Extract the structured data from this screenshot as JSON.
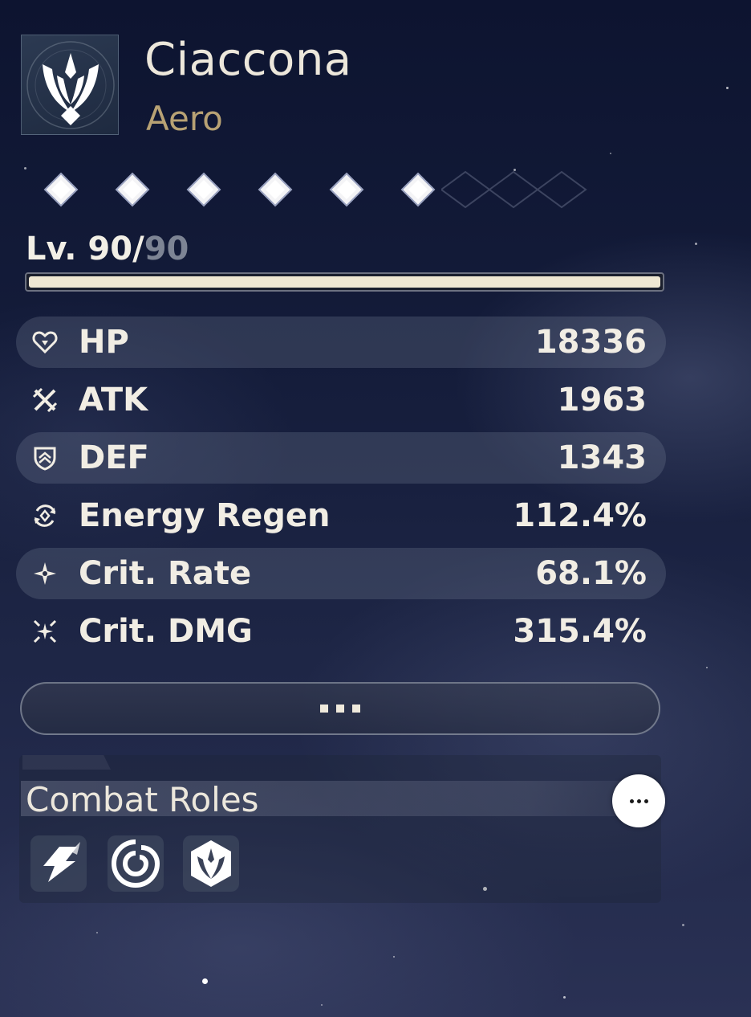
{
  "character": {
    "name": "Ciaccona",
    "element": "Aero",
    "emblem_icon": "aero-emblem-icon"
  },
  "sequence": {
    "nodes": 6,
    "node_icon": "diamond-node-icon"
  },
  "level": {
    "prefix": "Lv. ",
    "current": "90",
    "separator": "/",
    "max": "90",
    "progress": 1.0
  },
  "stats": [
    {
      "icon": "heart-icon",
      "name": "HP",
      "value": "18336",
      "shaded": true
    },
    {
      "icon": "crossed-swords-icon",
      "name": "ATK",
      "value": "1963",
      "shaded": false
    },
    {
      "icon": "shield-icon",
      "name": "DEF",
      "value": "1343",
      "shaded": true
    },
    {
      "icon": "energy-regen-icon",
      "name": "Energy Regen",
      "value": "112.4%",
      "shaded": false
    },
    {
      "icon": "star-icon",
      "name": "Crit. Rate",
      "value": "68.1%",
      "shaded": true
    },
    {
      "icon": "burst-star-icon",
      "name": "Crit. DMG",
      "value": "315.4%",
      "shaded": false
    }
  ],
  "more_button": {
    "icon": "more-dots-icon"
  },
  "combat_roles": {
    "title": "Combat Roles",
    "more_icon": "ellipsis-icon",
    "roles": [
      {
        "icon": "lightning-role-icon"
      },
      {
        "icon": "swirl-role-icon"
      },
      {
        "icon": "crest-role-icon"
      }
    ]
  },
  "colors": {
    "text": "#f1ede4",
    "element": "#b8a274",
    "level_max": "#7d8494",
    "bar_fill": "#efe7d2"
  }
}
